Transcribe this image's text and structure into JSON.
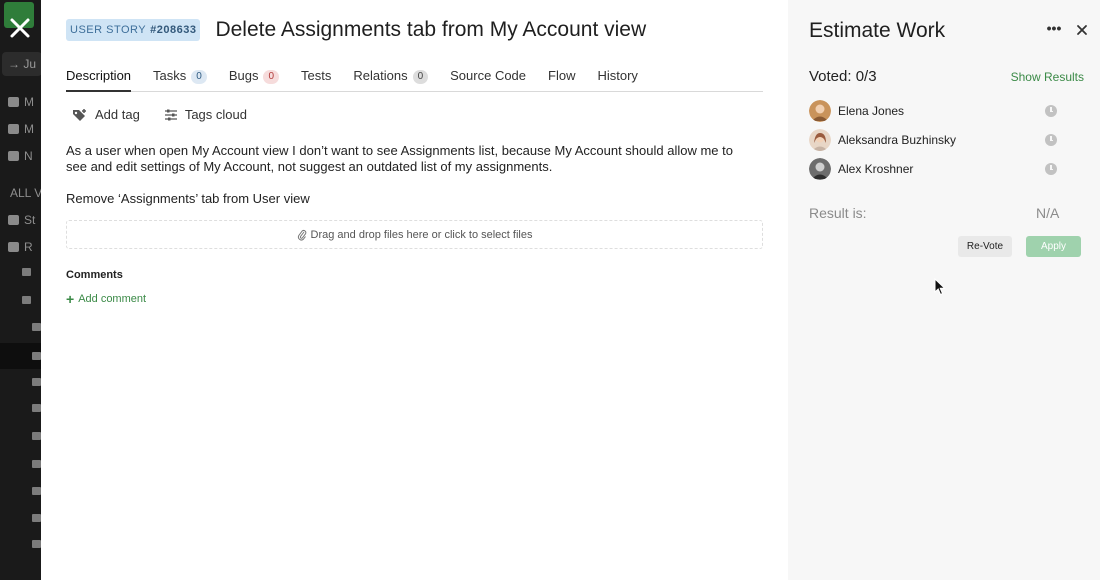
{
  "background_app": {
    "jump_text": "Ju",
    "rows": [
      "M",
      "M",
      "N",
      "ALL V",
      "St",
      "R"
    ]
  },
  "entity": {
    "type_label": "USER STORY",
    "id": "#208633",
    "title": "Delete Assignments tab from My Account view",
    "type_color": "#cfe4f5"
  },
  "tabs": [
    {
      "label": "Description",
      "active": true
    },
    {
      "label": "Tasks",
      "count": "0",
      "count_style": "blue"
    },
    {
      "label": "Bugs",
      "count": "0",
      "count_style": "red"
    },
    {
      "label": "Tests"
    },
    {
      "label": "Relations",
      "count": "0",
      "count_style": "grey"
    },
    {
      "label": "Source Code"
    },
    {
      "label": "Flow"
    },
    {
      "label": "History"
    }
  ],
  "tag_actions": {
    "add_tag": "Add tag",
    "tags_cloud": "Tags cloud"
  },
  "description": {
    "paragraph1": "As a user when open My Account view I don’t want to see Assignments list, because My Account should allow me to see and edit settings of My Account, not suggest an outdated list of my assignments.",
    "paragraph2": "Remove ‘Assignments’ tab from User view"
  },
  "attachments": {
    "dropzone_text": "Drag and drop files here or click to select files"
  },
  "comments": {
    "heading": "Comments",
    "add_label": "Add comment"
  },
  "estimate": {
    "title": "Estimate Work",
    "voted": "Voted: 0/3",
    "show_results": "Show Results",
    "voters": [
      {
        "name": "Elena Jones"
      },
      {
        "name": "Aleksandra Buzhinsky"
      },
      {
        "name": "Alex Kroshner"
      }
    ],
    "result_label": "Result is:",
    "result_value": "N/A",
    "revote_label": "Re-Vote",
    "apply_label": "Apply"
  },
  "colors": {
    "accent_green": "#3b8a47",
    "apply_disabled": "#9fd2ad"
  }
}
